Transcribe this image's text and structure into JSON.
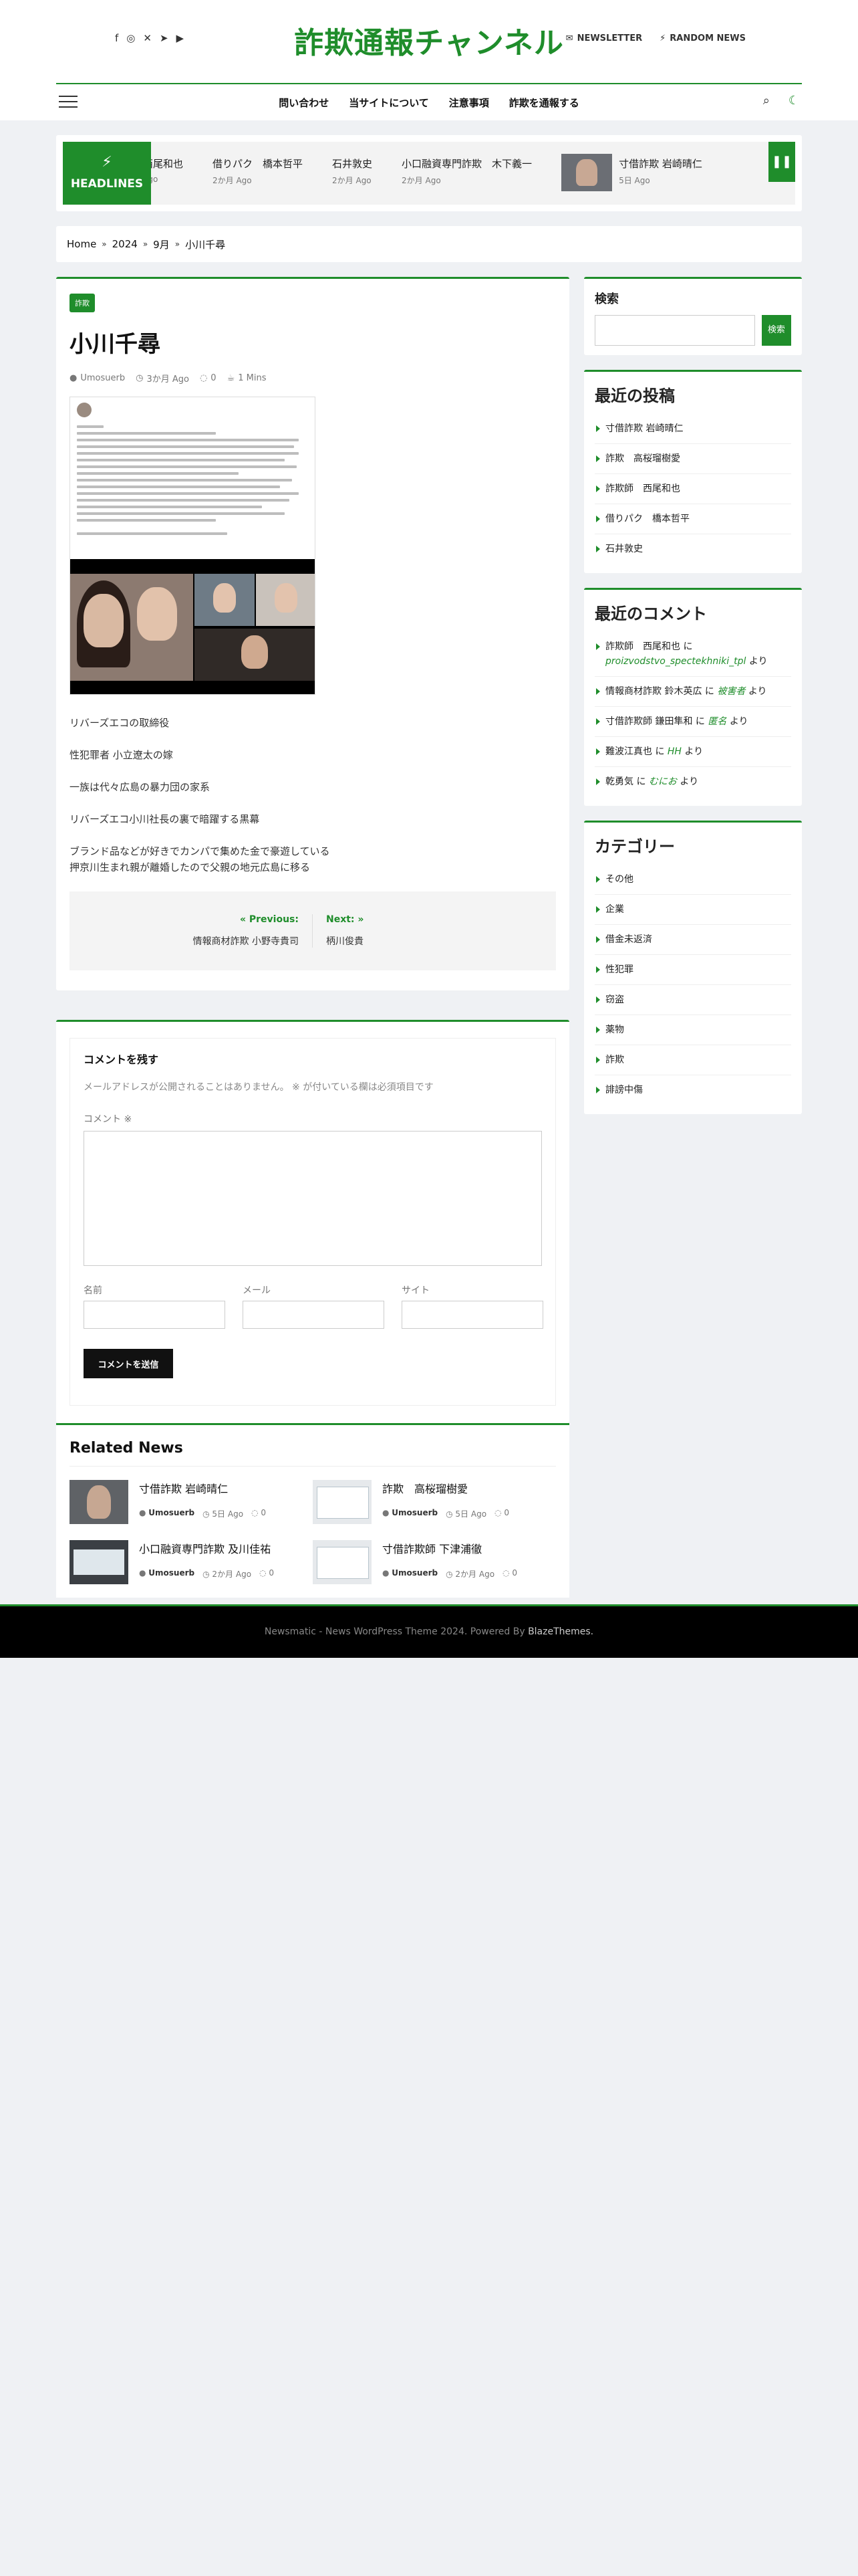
{
  "site": {
    "title": "詐欺通報チャンネル"
  },
  "top_links": {
    "newsletter": "NEWSLETTER",
    "random_news": "RANDOM NEWS"
  },
  "nav": {
    "items": [
      "問い合わせ",
      "当サイトについて",
      "注意事項",
      "詐欺を通報する"
    ]
  },
  "ticker": {
    "badge": "HEADLINES",
    "items": [
      {
        "title": "西尾和也",
        "meta": "ago"
      },
      {
        "title": "借りパク　橋本哲平",
        "meta": "2か月 Ago"
      },
      {
        "title": "石井敦史",
        "meta": "2か月 Ago"
      },
      {
        "title": "小口融資専門詐欺　木下義一",
        "meta": "2か月 Ago"
      },
      {
        "title": "寸借詐欺 岩崎晴仁",
        "meta": "5日 Ago"
      }
    ]
  },
  "breadcrumb": [
    "Home",
    "2024",
    "9月",
    "小川千尋"
  ],
  "article": {
    "category": "詐欺",
    "title": "小川千尋",
    "author": "Umosuerb",
    "date": "3か月 Ago",
    "comments": "0",
    "read_time": "1 Mins",
    "paragraphs": [
      "リバーズエコの取締役",
      "性犯罪者 小立遼太の嫁",
      "一族は代々広島の暴力団の家系",
      "リバーズエコ小川社長の裏で暗躍する黒幕",
      "ブランド品などが好きでカンパで集めた金で豪遊している\n押京川生まれ親が離婚したので父親の地元広島に移る"
    ]
  },
  "post_nav": {
    "prev_label": "Previous:",
    "prev_title": "情報商材詐欺 小野寺貴司",
    "next_label": "Next:",
    "next_title": "柄川俊貴"
  },
  "comments": {
    "heading": "コメントを残す",
    "note": "メールアドレスが公開されることはありません。 ※ が付いている欄は必須項目です",
    "comment_label": "コメント ※",
    "name_label": "名前",
    "email_label": "メール",
    "site_label": "サイト",
    "submit": "コメントを送信"
  },
  "related": {
    "heading": "Related News",
    "items": [
      {
        "title": "寸借詐欺 岩崎晴仁",
        "author": "Umosuerb",
        "date": "5日 Ago",
        "comments": "0",
        "thumb": "face"
      },
      {
        "title": "詐欺　高桜瑠樹愛",
        "author": "Umosuerb",
        "date": "5日 Ago",
        "comments": "0",
        "thumb": "card"
      },
      {
        "title": "小口融資専門詐欺 及川佳祐",
        "author": "Umosuerb",
        "date": "2か月 Ago",
        "comments": "0",
        "thumb": "dark"
      },
      {
        "title": "寸借詐欺師 下津浦徹",
        "author": "Umosuerb",
        "date": "2か月 Ago",
        "comments": "0",
        "thumb": "card"
      }
    ]
  },
  "sidebar": {
    "search_title": "検索",
    "search_button": "検索",
    "recent_posts_title": "最近の投稿",
    "recent_posts": [
      "寸借詐欺 岩崎晴仁",
      "詐欺　高桜瑠樹愛",
      "詐欺師　西尾和也",
      "借りパク　橋本哲平",
      "石井敦史"
    ],
    "recent_comments_title": "最近のコメント",
    "recent_comments": [
      {
        "post": "詐欺師　西尾和也",
        "mid": "に",
        "author": "proizvodstvo_spectekhniki_tpl",
        "tail": "より"
      },
      {
        "post": "情報商材詐欺 鈴木英広",
        "mid": "に",
        "author": "被害者",
        "tail": "より"
      },
      {
        "post": "寸借詐欺師 鎌田隼和",
        "mid": "に",
        "author": "匿名",
        "tail": "より"
      },
      {
        "post": "難波江真也",
        "mid": "に",
        "author": "HH",
        "tail": "より"
      },
      {
        "post": "乾勇気",
        "mid": "に",
        "author": "むにお",
        "tail": "より"
      }
    ],
    "categories_title": "カテゴリー",
    "categories": [
      "その他",
      "企業",
      "借金未返済",
      "性犯罪",
      "窃盗",
      "薬物",
      "詐欺",
      "誹謗中傷"
    ]
  },
  "footer": {
    "text": "Newsmatic - News WordPress Theme 2024. Powered By ",
    "brand": "BlazeThemes."
  },
  "colors": {
    "accent": "#1f8d2b"
  }
}
